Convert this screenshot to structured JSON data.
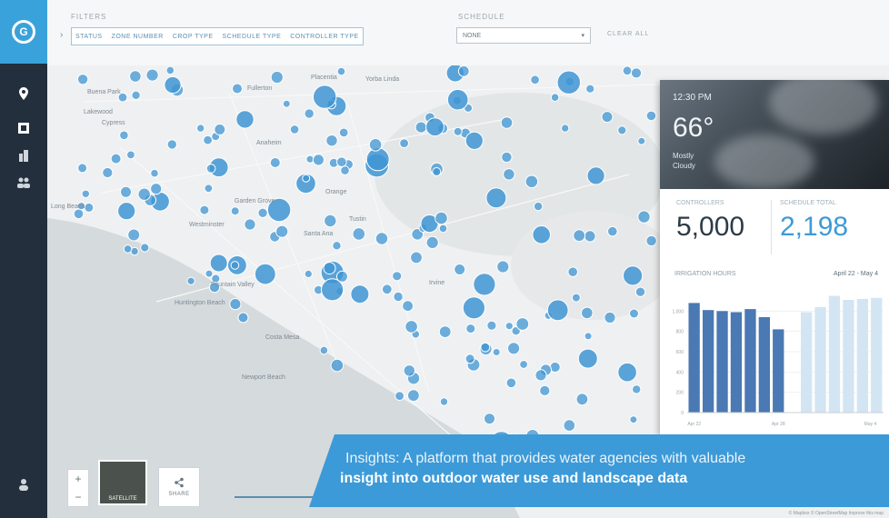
{
  "nav": {
    "logo_glyph": "G",
    "items": [
      {
        "name": "map-pin-icon",
        "glyph": "pin"
      },
      {
        "name": "grid-icon",
        "glyph": "grid"
      },
      {
        "name": "buildings-icon",
        "glyph": "buildings"
      },
      {
        "name": "users-icon",
        "glyph": "users"
      }
    ],
    "profile_icon": "user-icon"
  },
  "filters": {
    "label": "FILTERS",
    "chips": [
      "STATUS",
      "ZONE NUMBER",
      "CROP TYPE",
      "SCHEDULE TYPE",
      "CONTROLLER TYPE"
    ],
    "dropdown_label": "SCHEDULE",
    "dropdown_value": "NONE",
    "clear_label": "CLEAR ALL"
  },
  "map": {
    "places": [
      "Buena Park",
      "Fullerton",
      "Placentia",
      "Yorba Linda",
      "Cypress",
      "Anaheim",
      "Orange",
      "Garden Grove",
      "Westminster",
      "Santa Ana",
      "Fountain Valley",
      "Huntington Beach",
      "Costa Mesa",
      "Newport Beach",
      "Irvine",
      "Tustin",
      "Lakewood",
      "Long Beach"
    ],
    "marker_color": "#3f95d3",
    "accent_color": "#2f86c8"
  },
  "weather": {
    "time": "12:30 PM",
    "temperature": "66°",
    "condition_line1": "Mostly",
    "condition_line2": "Cloudy"
  },
  "stats": {
    "left_label": "CONTROLLERS",
    "left_value": "5,000",
    "right_label": "SCHEDULE TOTAL",
    "right_value": "2,198"
  },
  "usage": {
    "title": "IRRIGATION HOURS",
    "range": "April 22 - May 4"
  },
  "chart_data": {
    "type": "bar",
    "title": "IRRIGATION HOURS",
    "xlabel": "",
    "ylabel": "",
    "ylim": [
      0,
      1200
    ],
    "yticks": [
      "1,000",
      "800",
      "600",
      "400",
      "200",
      "0"
    ],
    "x_tick_labels": [
      "Apr 22",
      "Apr 28",
      "May 4"
    ],
    "series": [
      {
        "values": [
          1080,
          1010,
          1000,
          990,
          1020,
          940,
          820,
          0,
          990,
          1040,
          1150,
          1110,
          1120,
          1130
        ]
      }
    ]
  },
  "controls": {
    "zoom_in": "+",
    "zoom_out": "−",
    "satellite_label": "SATELLITE",
    "share_label": "SHARE"
  },
  "caption": {
    "line1": "Insights: A platform that provides water agencies with valuable",
    "line2": "insight into outdoor water use and landscape data"
  },
  "attribution": "© Mapbox © OpenStreetMap Improve this map"
}
